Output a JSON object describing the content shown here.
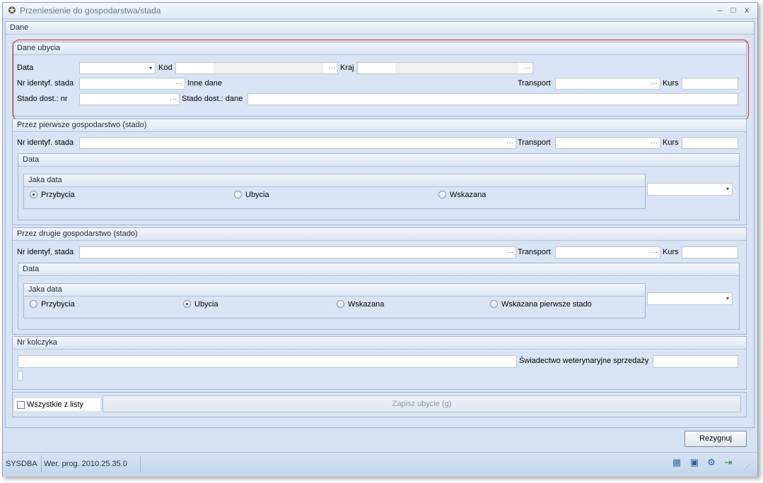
{
  "window": {
    "title": "Przeniesienie do gospodarstwa/stada",
    "minimize": "–",
    "maximize": "□",
    "close": "x"
  },
  "dane": {
    "header": "Dane",
    "ubycia": {
      "header": "Dane ubycia",
      "data_label": "Data",
      "kod_label": "Kod",
      "kraj_label": "Kraj",
      "nr_identyf_label": "Nr identyf. stada",
      "inne_dane_label": "Inne dane",
      "transport_label": "Transport",
      "kurs_label": "Kurs",
      "stado_nr_label": "Stado dost.: nr",
      "stado_dane_label": "Stado dost.: dane",
      "ellipsis": "···",
      "dropdown": "▾"
    },
    "pierwsze": {
      "header": "Przez pierwsze gospodarstwo (stado)",
      "nr_identyf_label": "Nr identyf. stada",
      "transport_label": "Transport",
      "kurs_label": "Kurs",
      "data_header": "Data",
      "jaka_data_header": "Jaka data",
      "options": [
        "Przybycia",
        "Ubycia",
        "Wskazana"
      ],
      "selected": "Przybycia"
    },
    "drugie": {
      "header": "Przez drugie gospodarstwo (stado)",
      "nr_identyf_label": "Nr identyf. stada",
      "transport_label": "Transport",
      "kurs_label": "Kurs",
      "data_header": "Data",
      "jaka_data_header": "Jaka data",
      "options": [
        "Przybycia",
        "Ubycia",
        "Wskazana",
        "Wskazana pierwsze stado"
      ],
      "selected": "Ubycia"
    },
    "kolczyk": {
      "header": "Nr kolczyka",
      "swiadectwo_label": "Świadectwo weterynaryjne sprzedaży"
    },
    "bottom": {
      "wszystkie_label": "Wszystkie z listy",
      "zapisz_label": "Zapisz ubycie (g)"
    }
  },
  "footer": {
    "rezygnuj_label": "Rezygnuj"
  },
  "statusbar": {
    "user": "SYSDBA",
    "version": "Wer. prog. 2010.25.35.0",
    "icons": [
      "grid-icon",
      "disk-icon",
      "gear-icon",
      "exit-icon"
    ]
  }
}
